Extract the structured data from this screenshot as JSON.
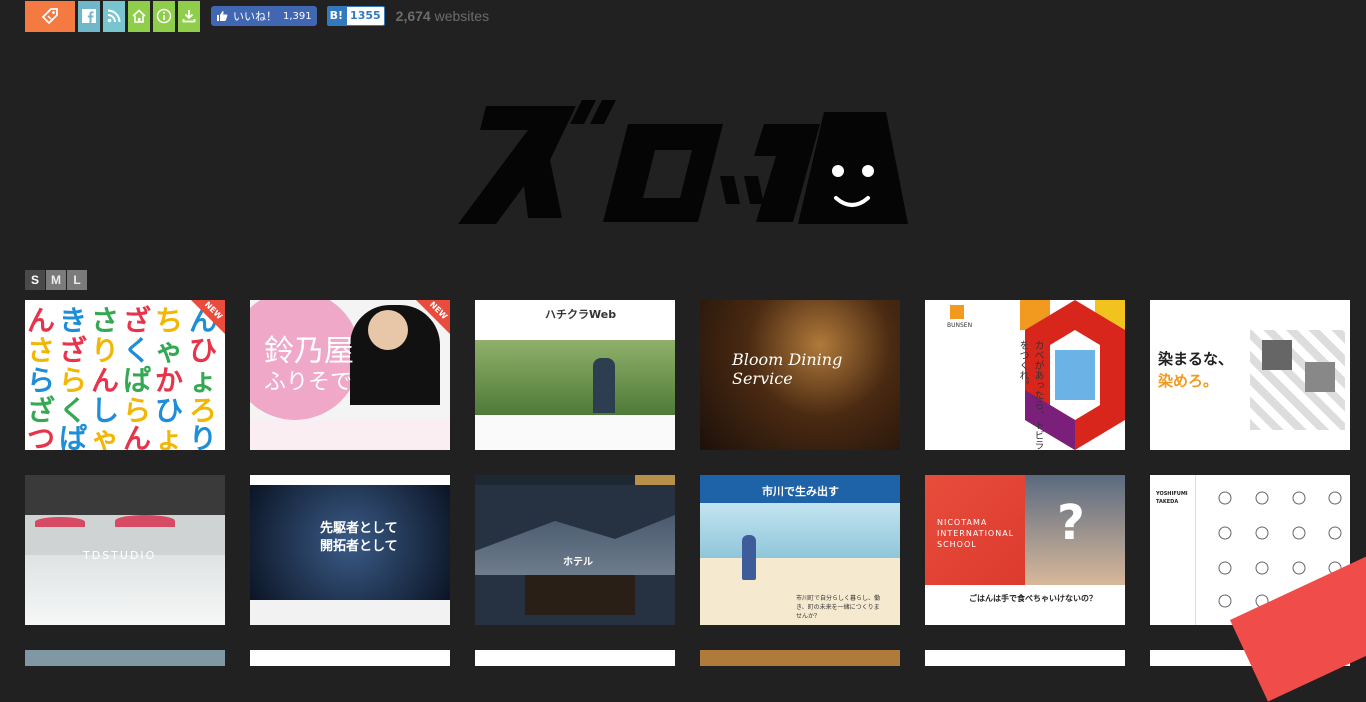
{
  "topbar": {
    "tag_icon": "tag-icon",
    "social_icons": [
      "facebook-icon",
      "rss-icon",
      "home-icon",
      "info-icon",
      "download-icon"
    ],
    "like_label": "いいね！",
    "like_count": "1,391",
    "hatena_label": "B!",
    "hatena_count": "1355",
    "site_count": "2,674",
    "site_count_suffix": "websites"
  },
  "size_options": [
    "S",
    "M",
    "L"
  ],
  "thumbs": {
    "t1": {
      "new": "NEW"
    },
    "t2": {
      "title": "鈴乃屋",
      "subtitle": "ふりそで",
      "new": "NEW"
    },
    "t3": {
      "brand": "ハチクラWeb"
    },
    "t4": {
      "title": "Bloom Dining Service"
    },
    "t5": {
      "text": "カベがあったら、トビラをつくれ。",
      "brand": "BUNSEN"
    },
    "t6": {
      "line1": "染まるな、",
      "line2": "染めろ。"
    },
    "t7": {
      "title": "TDSTUDIO"
    },
    "t8": {
      "line1": "先駆者として",
      "line2": "開拓者として"
    },
    "t9": {
      "brand": "ホテル"
    },
    "t10": {
      "banner": "市川で生み出す",
      "caption": "市川町で自分らしく暮らし、働き、町の未来を一緒につくりませんか？"
    },
    "t11": {
      "title": "NICOTAMA INTERNATIONAL SCHOOL",
      "caption": "ごはんは手で食べちゃいけないの？"
    },
    "t12": {
      "name1": "YOSHIFUMI",
      "name2": "TAKEDA"
    }
  },
  "colors": {
    "background": "#212121",
    "accent": "#f47a42",
    "green": "#8fce4b"
  }
}
